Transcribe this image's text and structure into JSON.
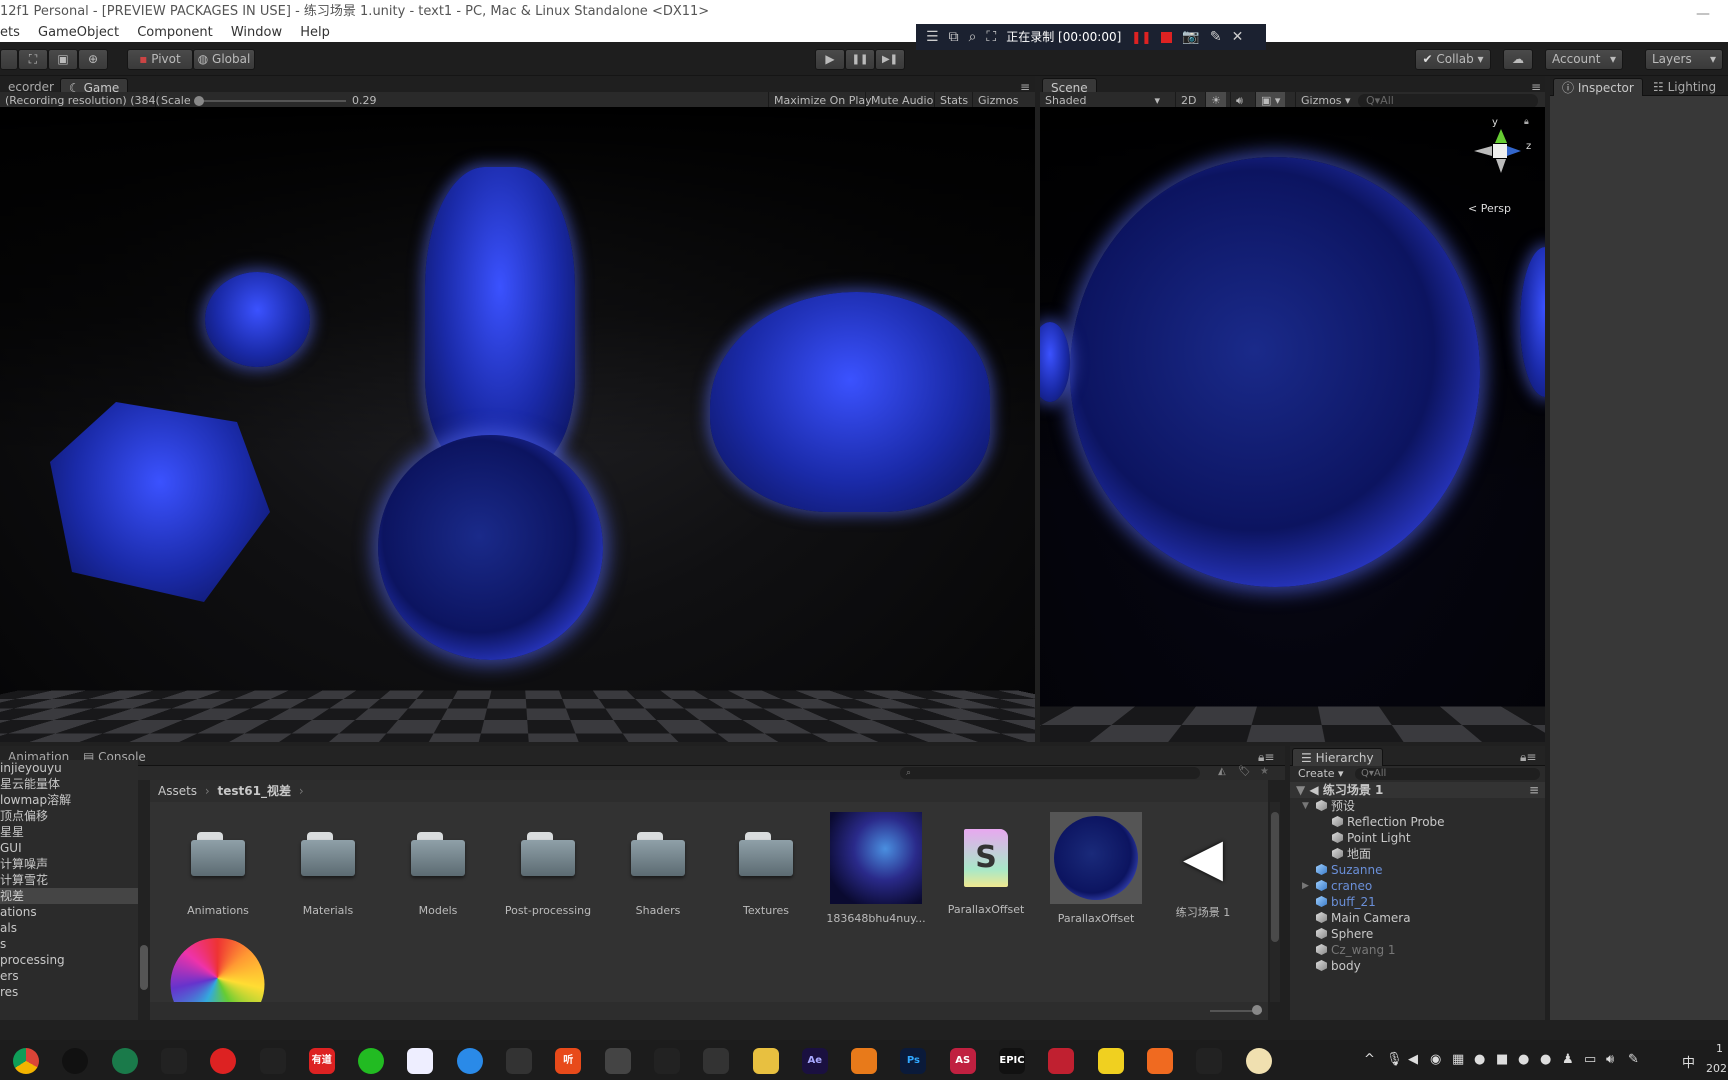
{
  "window": {
    "title": "12f1 Personal - [PREVIEW PACKAGES IN USE] - 练习场景 1.unity - text1 - PC, Mac & Linux Standalone <DX11>",
    "minimize": "—"
  },
  "menu": [
    "ets",
    "GameObject",
    "Component",
    "Window",
    "Help"
  ],
  "toolbar": {
    "pivot": "Pivot",
    "global": "Global",
    "collab": "Collab ▾",
    "account": "Account",
    "layers": "Layers",
    "play_icon": "▶",
    "pause_icon": "❚❚",
    "step_icon": "▶❚"
  },
  "recorder_overlay": {
    "status": "正在录制 [00:00:00]",
    "icons": [
      "menu-icon",
      "window-icon",
      "region-icon",
      "crop-icon",
      "pause-icon",
      "stop-icon",
      "camera-icon",
      "pen-icon",
      "close-icon"
    ]
  },
  "game": {
    "tabs": [
      "ecorder",
      "Game"
    ],
    "resolution": "(Recording resolution) (384(",
    "scale_label": "Scale",
    "scale_value": "0.29",
    "maximize": "Maximize On Play",
    "mute": "Mute Audio",
    "stats": "Stats",
    "gizmos": "Gizmos"
  },
  "scene": {
    "tab": "Scene",
    "shading": "Shaded",
    "twod": "2D",
    "gizmos": "Gizmos",
    "search_placeholder": "Q▾All",
    "axis_y": "y",
    "axis_z": "z",
    "persp": "< Persp"
  },
  "right_tabs": {
    "inspector": "Inspector",
    "lighting": "Lighting"
  },
  "bottom_tabs": {
    "animation": "Animation",
    "console": "Console"
  },
  "project_tree": [
    {
      "label": "injieyouyu",
      "selected": false
    },
    {
      "label": "星云能量体",
      "selected": false
    },
    {
      "label": "lowmap溶解",
      "selected": false
    },
    {
      "label": "顶点偏移",
      "selected": false
    },
    {
      "label": "星星",
      "selected": false
    },
    {
      "label": "GUI",
      "selected": false
    },
    {
      "label": "计算噪声",
      "selected": false
    },
    {
      "label": "计算雪花",
      "selected": false
    },
    {
      "label": "视差",
      "selected": true
    },
    {
      "label": "ations",
      "selected": false
    },
    {
      "label": "als",
      "selected": false
    },
    {
      "label": "s",
      "selected": false
    },
    {
      "label": "processing",
      "selected": false
    },
    {
      "label": "ers",
      "selected": false
    },
    {
      "label": "res",
      "selected": false
    }
  ],
  "breadcrumb": {
    "root": "Assets",
    "folder": "test61_视差"
  },
  "assets": [
    {
      "name": "Animations",
      "type": "folder"
    },
    {
      "name": "Materials",
      "type": "folder"
    },
    {
      "name": "Models",
      "type": "folder"
    },
    {
      "name": "Post-processing",
      "type": "folder"
    },
    {
      "name": "Shaders",
      "type": "folder"
    },
    {
      "name": "Textures",
      "type": "folder"
    },
    {
      "name": "183648bhu4nuy...",
      "type": "texture"
    },
    {
      "name": "ParallaxOffset",
      "type": "shader"
    },
    {
      "name": "ParallaxOffset",
      "type": "material"
    },
    {
      "name": "练习场景 1",
      "type": "scene"
    }
  ],
  "hierarchy": {
    "tab": "Hierarchy",
    "create": "Create ▾",
    "search_placeholder": "Q▾All",
    "scene": "练习场景 1",
    "items": [
      {
        "label": "预设",
        "indent": 1,
        "color": "#c8c8c8",
        "expand": "▼"
      },
      {
        "label": "Reflection Probe",
        "indent": 2,
        "color": "#c8c8c8"
      },
      {
        "label": "Point Light",
        "indent": 2,
        "color": "#c8c8c8"
      },
      {
        "label": "地面",
        "indent": 2,
        "color": "#c8c8c8"
      },
      {
        "label": "Suzanne",
        "indent": 1,
        "color": "#6a8fd8",
        "prefab": true
      },
      {
        "label": "craneo",
        "indent": 1,
        "color": "#6a8fd8",
        "prefab": true,
        "expand": "▶"
      },
      {
        "label": "buff_21",
        "indent": 1,
        "color": "#6a8fd8",
        "prefab": true
      },
      {
        "label": "Main Camera",
        "indent": 1,
        "color": "#c8c8c8"
      },
      {
        "label": "Sphere",
        "indent": 1,
        "color": "#c8c8c8"
      },
      {
        "label": "Cz_wang 1",
        "indent": 1,
        "color": "#777777"
      },
      {
        "label": "body",
        "indent": 1,
        "color": "#c8c8c8"
      }
    ]
  },
  "taskbar": {
    "apps": [
      "Chrome",
      "Recorder",
      "Player",
      "Paw",
      "NetEase Music",
      "QQ",
      "Youdao",
      "WeChat",
      "Baidu Netdisk",
      "Feishu",
      "Tiles",
      "Ting",
      "Drop",
      "Unreal",
      "Tool",
      "Explorer",
      "After Effects",
      "Blender",
      "Photoshop",
      "AS",
      "Epic Games",
      "Substance",
      "Player",
      "Pixso",
      "Unity",
      "Avatar"
    ],
    "labels": {
      "ae": "Ae",
      "ps": "Ps",
      "as": "AS",
      "epic": "EPIC",
      "youdao": "有道",
      "ting": "听"
    },
    "ime": "中",
    "clock_top": "1",
    "clock_bottom": "202"
  }
}
